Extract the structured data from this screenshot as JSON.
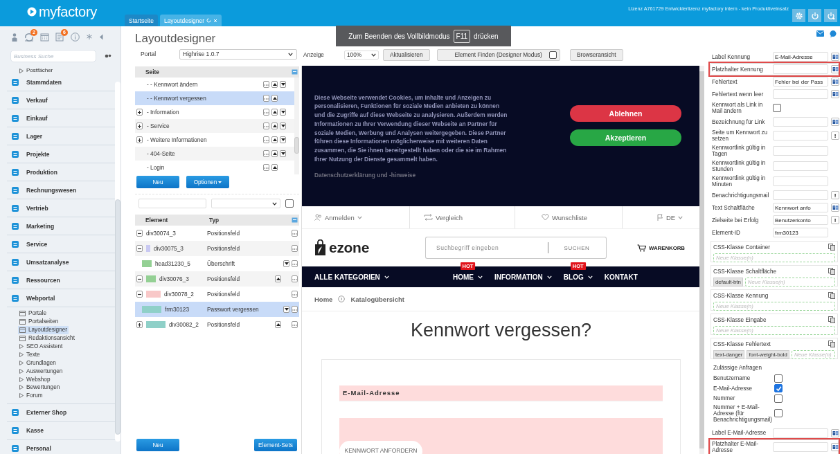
{
  "topbar": {
    "logo": "myfactory",
    "tabs": [
      {
        "label": "Startseite",
        "selected": false
      },
      {
        "label": "Layoutdesigner",
        "selected": true
      }
    ],
    "license": "Lizenz A761729 Entwicklerlizenz myfactory intern - kein Produktiveinsatz"
  },
  "fullscreen_notice": {
    "text_before": "Zum Beenden des Vollbildmodus",
    "key": "F11",
    "text_after": "drücken"
  },
  "sidebar": {
    "toolbar": [
      {
        "kind": "person"
      },
      {
        "kind": "sync",
        "badge": "2"
      },
      {
        "kind": "calendar"
      },
      {
        "kind": "notes",
        "badge": "6"
      },
      {
        "kind": "info"
      },
      {
        "kind": "asterisk"
      },
      {
        "kind": "collapse"
      }
    ],
    "search": {
      "placeholder": "Business Suche"
    },
    "scrolled_item": {
      "label": "Postfächer"
    },
    "modules": [
      {
        "label": "Stammdaten"
      },
      {
        "label": "Verkauf"
      },
      {
        "label": "Einkauf"
      },
      {
        "label": "Lager"
      },
      {
        "label": "Projekte"
      },
      {
        "label": "Produktion"
      },
      {
        "label": "Rechnungswesen"
      },
      {
        "label": "Vertrieb"
      },
      {
        "label": "Marketing"
      },
      {
        "label": "Service"
      },
      {
        "label": "Umsatzanalyse"
      },
      {
        "label": "Ressourcen"
      },
      {
        "label": "Webportal",
        "children": [
          {
            "label": "Portale",
            "kind": "page",
            "selected": false
          },
          {
            "label": "Portalseiten",
            "kind": "page",
            "selected": false
          },
          {
            "label": "Layoutdesigner",
            "kind": "page",
            "selected": true
          },
          {
            "label": "Redaktionsansicht",
            "kind": "page",
            "selected": false
          },
          {
            "label": "SEO Assistent",
            "kind": "folder",
            "selected": false
          },
          {
            "label": "Texte",
            "kind": "folder",
            "selected": false
          },
          {
            "label": "Grundlagen",
            "kind": "folder",
            "selected": false
          },
          {
            "label": "Auswertungen",
            "kind": "folder",
            "selected": false
          },
          {
            "label": "Webshop",
            "kind": "folder",
            "selected": false
          },
          {
            "label": "Bewertungen",
            "kind": "folder",
            "selected": false
          },
          {
            "label": "Forum",
            "kind": "folder",
            "selected": false
          }
        ]
      },
      {
        "label": "Externer Shop"
      },
      {
        "label": "Kasse"
      },
      {
        "label": "Personal"
      }
    ]
  },
  "layout_panel": {
    "title": "Layoutdesigner",
    "portal": {
      "label": "Portal",
      "value": "Highrise 1.0.7"
    },
    "pages": {
      "column": "Seite",
      "rows": [
        {
          "label": "- - Kennwort ändern",
          "expandable": false,
          "selected": false,
          "move_up": true,
          "move_down": true
        },
        {
          "label": "- - Kennwort vergessen",
          "expandable": false,
          "selected": true,
          "move_up": true,
          "move_down": false
        },
        {
          "label": "- Information",
          "expandable": true,
          "selected": false,
          "move_up": true,
          "move_down": true
        },
        {
          "label": "- Service",
          "expandable": true,
          "selected": false,
          "move_up": true,
          "move_down": true
        },
        {
          "label": "- Weitere Informationen",
          "expandable": true,
          "selected": false,
          "move_up": true,
          "move_down": true
        },
        {
          "label": "- 404-Seite",
          "expandable": false,
          "selected": false,
          "move_up": true,
          "move_down": true
        },
        {
          "label": "- Login",
          "expandable": false,
          "selected": false,
          "move_up": true,
          "move_down": false
        }
      ]
    },
    "page_buttons": [
      "Neu",
      "Optionen"
    ],
    "filter": {
      "checked": false
    },
    "elements": {
      "columns": [
        "Element",
        "Typ"
      ],
      "rows": [
        {
          "name": "div30074_3",
          "type": "Positionsfeld",
          "expanded": true,
          "selected": false,
          "move_up": false,
          "move_down": false,
          "children": [
            {
              "name": "div30075_3",
              "type": "Positionsfeld",
              "color": "#c9c9f2",
              "expanded": true,
              "selected": false,
              "move_up": false,
              "move_down": false,
              "children": [
                {
                  "name": "head31230_5",
                  "type": "Überschrift",
                  "color": "#94d094",
                  "selected": false,
                  "move_up": false,
                  "move_down": true
                },
                {
                  "name": "div30076_3",
                  "type": "Positionsfeld",
                  "color": "#94d094",
                  "expanded": true,
                  "selected": false,
                  "move_up": true,
                  "move_down": false,
                  "children": [
                    {
                      "name": "div30078_2",
                      "type": "Positionsfeld",
                      "color": "#f8c8c8",
                      "expanded": true,
                      "selected": false,
                      "move_up": false,
                      "move_down": false,
                      "children": [
                        {
                          "name": "frm30123",
                          "type": "Passwort vergessen",
                          "color": "#8fd0c8",
                          "selected": true,
                          "move_up": false,
                          "move_down": true
                        },
                        {
                          "name": "div30082_2",
                          "type": "Positionsfeld",
                          "color": "#8fd0c8",
                          "expanded": false,
                          "selected": false,
                          "move_up": true,
                          "move_down": false
                        }
                      ]
                    }
                  ]
                }
              ]
            }
          ]
        }
      ]
    },
    "bottom_buttons": [
      "Neu",
      "Element-Sets"
    ]
  },
  "designer": {
    "toolbar": {
      "zoom_label": "Anzeige",
      "zoom": "100%",
      "refresh": "Aktualisieren",
      "find": {
        "label": "Element Finden (Designer Modus)",
        "checked": false
      },
      "browser_view": "Browseransicht"
    },
    "preview": {
      "cookie_banner": {
        "text": "Diese Webseite verwendet Cookies, um Inhalte und Anzeigen zu personalisieren, Funktionen für soziale Medien anbieten zu können und die Zugriffe auf diese Webseite zu analysieren. Außerdem werden Informationen zu Ihrer Verwendung dieser Webseite an Partner für soziale Medien, Werbung und Analysen weitergegeben. Diese Partner führen diese Informationen möglicherweise mit weiteren Daten zusammen, die Sie ihnen bereitgestellt haben oder die sie im Rahmen Ihrer Nutzung der Dienste gesammelt haben.",
        "link": "Datenschutzerklärung und -hinweise",
        "buttons": [
          {
            "label": "Ablehnen",
            "kind": "decline"
          },
          {
            "label": "Akzeptieren",
            "kind": "accept"
          }
        ]
      },
      "top_links": [
        {
          "label": "Anmelden",
          "kind": "account",
          "dropdown": true
        },
        {
          "label": "Vergleich",
          "kind": "compare",
          "dropdown": false
        },
        {
          "label": "Wunschliste",
          "kind": "wishlist",
          "dropdown": false
        },
        {
          "label": "DE",
          "kind": "language",
          "dropdown": true
        }
      ],
      "logo": "ezone",
      "search": {
        "placeholder": "Suchbegriff eingeben",
        "button": "SUCHEN"
      },
      "cart": "WARENKORB",
      "nav": {
        "categories": "ALLE KATEGORIEN",
        "items": [
          {
            "label": "HOME",
            "dropdown": true,
            "badge": "HOT"
          },
          {
            "label": "INFORMATION",
            "dropdown": true
          },
          {
            "label": "BLOG",
            "dropdown": true,
            "badge": "HOT"
          },
          {
            "label": "KONTAKT",
            "dropdown": false
          }
        ]
      },
      "breadcrumb": [
        "Home",
        "Katalogübersicht"
      ],
      "heading": "Kennwort vergessen?",
      "form": {
        "label": "E-Mail-Adresse",
        "button": "KENNWORT ANFORDERN"
      }
    }
  },
  "properties": {
    "rows": [
      {
        "label": "Label Kennung",
        "kind": "text",
        "value": "E-Mail-Adresse",
        "translatable": true,
        "highlighted": false
      },
      {
        "label": "Platzhalter Kennung",
        "kind": "text",
        "translatable": true,
        "highlighted": true
      },
      {
        "label": "Fehlertext",
        "kind": "text",
        "value": "Fehler bei der Pass",
        "translatable": true,
        "highlighted": false
      },
      {
        "label": "Fehlertext wenn leer",
        "kind": "text",
        "translatable": true,
        "highlighted": false
      },
      {
        "label": "Kennwort als Link in Mail ändern",
        "kind": "checkbox",
        "checked": false,
        "highlighted": false
      },
      {
        "label": "Bezeichnung für Link",
        "kind": "text",
        "translatable": true,
        "highlighted": false
      },
      {
        "label": "Seite um Kennwort zu setzen",
        "kind": "text",
        "button": "!",
        "highlighted": false
      },
      {
        "label": "Kennwortlink gültig in Tagen",
        "kind": "text",
        "highlighted": false
      },
      {
        "label": "Kennwortlink gültig in Stunden",
        "kind": "text",
        "highlighted": false
      },
      {
        "label": "Kennwortlink gültig in Minuten",
        "kind": "text",
        "highlighted": false
      },
      {
        "label": "Benachrichtigungsmail",
        "kind": "text",
        "button": "!",
        "highlighted": false
      },
      {
        "label": "Text Schaltfläche",
        "kind": "text",
        "value": "Kennwort anfo",
        "translatable": true,
        "highlighted": false
      },
      {
        "label": "Zielseite bei Erfolg",
        "kind": "text",
        "value": "Benutzerkonto",
        "button": "!",
        "highlighted": false
      },
      {
        "label": "Element-ID",
        "kind": "text",
        "value": "frm30123",
        "highlighted": false
      }
    ],
    "css_groups": [
      {
        "title": "CSS-Klasse Container",
        "placeholder": "Neue Klasse(n)"
      },
      {
        "title": "CSS-Klasse Schaltfläche",
        "classes": [
          "default-btn"
        ],
        "placeholder": "Neue Klasse(n)"
      },
      {
        "title": "CSS-Klasse Kennung",
        "placeholder": "Neue Klasse(n)"
      },
      {
        "title": "CSS-Klasse Eingabe",
        "placeholder": "Neue Klasse(n)"
      },
      {
        "title": "CSS-Klasse Fehlertext",
        "classes": [
          "text-danger",
          "font-weight-bold"
        ],
        "placeholder": "Neue Klasse(n)"
      }
    ],
    "requests": {
      "title": "Zulässige Anfragen",
      "options": [
        {
          "label": "Benutzername",
          "checked": false
        },
        {
          "label": "E-Mail-Adresse",
          "checked": true
        },
        {
          "label": "Nummer",
          "checked": false
        },
        {
          "label": "Nummer + E-Mail-Adresse (für Benachrichtigungsmail)",
          "checked": false
        }
      ]
    },
    "rows_after": [
      {
        "label": "Label E-Mail-Adresse",
        "kind": "text",
        "translatable": true,
        "highlighted": false
      },
      {
        "label": "Platzhalter E-Mail-Adresse",
        "kind": "text",
        "translatable": true,
        "highlighted": true
      }
    ]
  }
}
